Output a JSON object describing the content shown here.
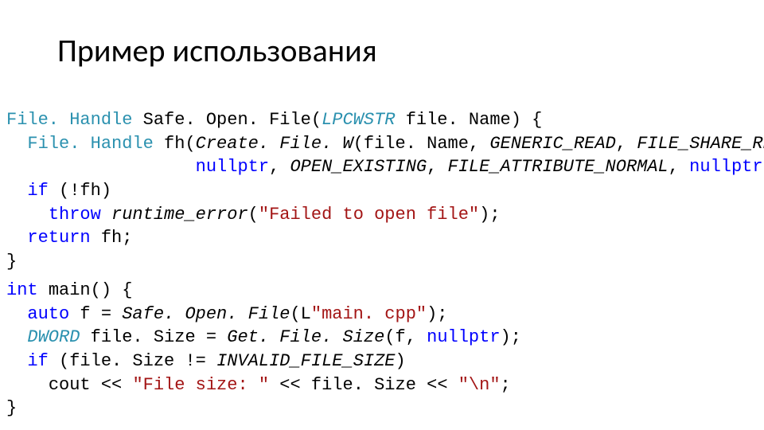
{
  "title": "Пример использования",
  "code1": {
    "type1": "File. Handle",
    "fn1": "Safe. Open. File",
    "paramtype": "LPCWSTR",
    "param1": "file. Name",
    "type2": "File. Handle",
    "var1": "fh",
    "callCreate": "Create. File. W",
    "argFileName": "file. Name",
    "genericRead": "GENERIC_READ",
    "fileShareRead": "FILE_SHARE_READ",
    "nullptr1": "nullptr",
    "openExisting": "OPEN_EXISTING",
    "fileAttrNormal": "FILE_ATTRIBUTE_NORMAL",
    "nullptr2": "nullptr",
    "ifKw": "if",
    "notFh": "(!fh)",
    "throwKw": "throw",
    "runtimeError": "runtime_error",
    "errMsg": "\"Failed to open file\"",
    "returnKw": "return",
    "retVar": "fh"
  },
  "code2": {
    "intKw": "int",
    "mainFn": "main",
    "autoKw": "auto",
    "fVar": "f = ",
    "safeOpen": "Safe. Open. File",
    "mainCppStr": "\"main. cpp\"",
    "lPrefix": "L",
    "dwordType": "DWORD",
    "fileSizeVar": "file. Size",
    "getFileSize": "Get. File. Size",
    "fArg": "f",
    "nullptrArg": "nullptr",
    "ifKw": "if",
    "invalidFileSize": "INVALID_FILE_SIZE",
    "cout": "cout",
    "fileSizeStr": "\"File size: \"",
    "newlineStr": "\"\\n\""
  }
}
